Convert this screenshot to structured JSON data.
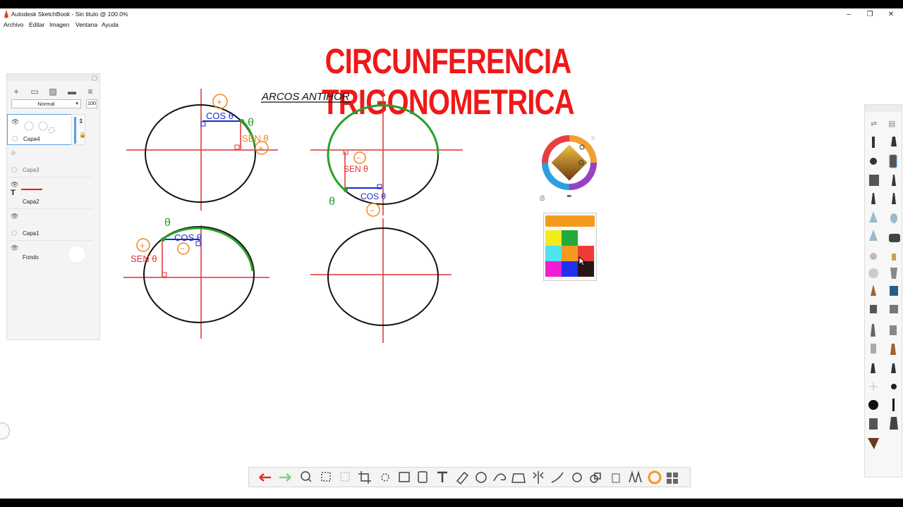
{
  "window": {
    "title": "Autodesk SketchBook - Sin titulo @ 100.0%",
    "controls": [
      "–",
      "❐",
      "✕"
    ]
  },
  "menu": [
    "Archivo",
    "Editar",
    "Imagen",
    "Ventana",
    "Ayuda"
  ],
  "canvas": {
    "title": "CIRCUNFERENCIA TRIGONOMETRICA",
    "handwriting_subtitle": "ARCOS ANTIHOR",
    "labels": {
      "cos_a": "COS θ",
      "sen_a": "SEN θ",
      "plus": "+",
      "minus": "−",
      "theta": "θ"
    }
  },
  "layers": {
    "blend_mode": "Normal",
    "opacity": "100",
    "items": [
      {
        "name": "Capa4",
        "visible": true,
        "active": true
      },
      {
        "name": "Capa3",
        "visible": false,
        "active": false
      },
      {
        "name": "Capa2",
        "visible": true,
        "active": false
      },
      {
        "name": "Capa1",
        "visible": true,
        "active": false
      },
      {
        "name": "Fondo",
        "visible": true,
        "active": false
      }
    ]
  },
  "colors": {
    "accent_red": "#f01818",
    "current_color": "#f39a1e",
    "swatches": [
      "#f2ec1a",
      "#22aa3a",
      "#ffffff",
      "#4fe3ef",
      "#f39a1e",
      "#f03a3a",
      "#f01ed2",
      "#2230f0",
      "#2a1515"
    ]
  },
  "toolbar": {
    "icons": [
      "undo-icon",
      "redo-icon",
      "zoom-icon",
      "select-icon",
      "transform-icon",
      "crop-icon",
      "move-icon",
      "distort-icon",
      "fill-icon",
      "text-icon",
      "ruler-icon",
      "ellipse-guide-icon",
      "french-curve-icon",
      "perspective-icon",
      "symmetry-icon",
      "stroke-icon",
      "shape-icon",
      "layers-icon",
      "brush-library-icon",
      "color-wheel-icon",
      "copic-icon"
    ]
  }
}
